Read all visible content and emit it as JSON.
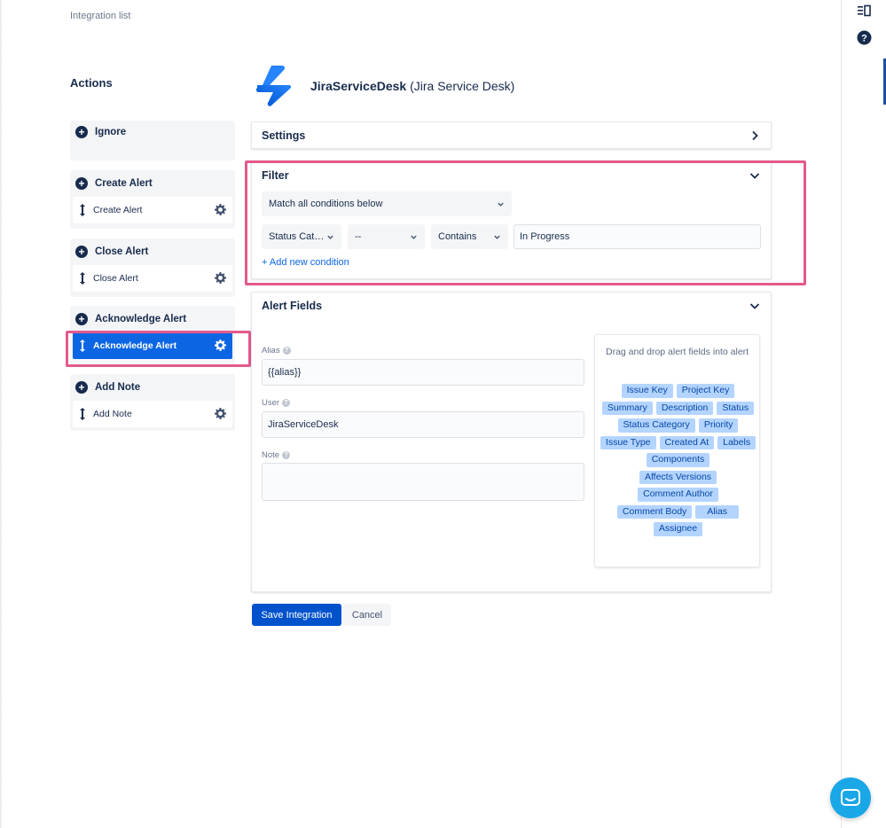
{
  "breadcrumb": "Integration list",
  "actions": {
    "title": "Actions",
    "groups": [
      {
        "label": "Ignore",
        "items": []
      },
      {
        "label": "Create Alert",
        "items": [
          "Create Alert"
        ]
      },
      {
        "label": "Close Alert",
        "items": [
          "Close Alert"
        ]
      },
      {
        "label": "Acknowledge Alert",
        "items": [
          "Acknowledge Alert"
        ]
      },
      {
        "label": "Add Note",
        "items": [
          "Add Note"
        ]
      }
    ]
  },
  "integration": {
    "name": "JiraServiceDesk",
    "type": "(Jira Service Desk)"
  },
  "settings": {
    "title": "Settings"
  },
  "filter": {
    "title": "Filter",
    "match": "Match all conditions below",
    "condition": {
      "field": "Status Cat…",
      "negate": "--",
      "operator": "Contains",
      "value": "In Progress"
    },
    "add_condition": "+ Add new condition"
  },
  "alert_fields": {
    "title": "Alert Fields",
    "alias_label": "Alias",
    "alias_value": "{{alias}}",
    "user_label": "User",
    "user_value": "JiraServiceDesk",
    "note_label": "Note",
    "note_value": "",
    "drag_hint": "Drag and drop alert fields into alert",
    "tags": [
      "Issue Key",
      "Project Key",
      "Summary",
      "Description",
      "Status",
      "Status Category",
      "Priority",
      "Issue Type",
      "Created At",
      "Labels",
      "Components",
      "Affects Versions",
      "Comment Author",
      "Comment Body",
      "Alias",
      "Assignee"
    ]
  },
  "buttons": {
    "save": "Save Integration",
    "cancel": "Cancel"
  },
  "colors": {
    "primary": "#0052cc",
    "highlight": "#e45a8c",
    "tag_bg": "#b3d4ff",
    "chat": "#1aa7e8"
  }
}
